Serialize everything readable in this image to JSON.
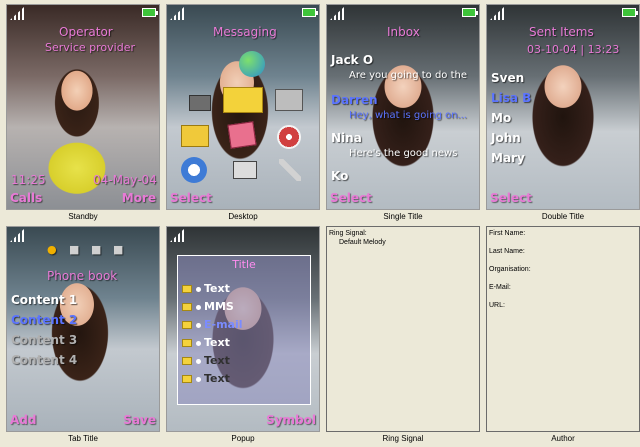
{
  "screens": {
    "standby": {
      "caption": "Standby",
      "operator": "Operator",
      "provider": "Service provider",
      "time": "11:25",
      "date": "04-May-04",
      "left_soft": "Calls",
      "right_soft": "More"
    },
    "desktop": {
      "caption": "Desktop",
      "title": "Messaging",
      "left_soft": "Select",
      "icons": [
        "envelope-icon",
        "radio-icon",
        "camera-icon",
        "folder-icon",
        "disc-icon",
        "tools-icon",
        "game-3d-icon",
        "clock-icon",
        "file-icon"
      ]
    },
    "single_title": {
      "caption": "Single Title",
      "title": "Inbox",
      "items": [
        {
          "name": "Jack O",
          "preview": "Are you going to do the",
          "color": "white"
        },
        {
          "name": "Darren",
          "preview": "Hey, what is going on...",
          "color": "blue"
        },
        {
          "name": "Nina",
          "preview": "Here's the good news",
          "color": "white"
        },
        {
          "name": "Ko",
          "preview": "",
          "color": "white"
        }
      ],
      "left_soft": "Select"
    },
    "double_title": {
      "caption": "Double Title",
      "title": "Sent Items",
      "subtitle": "03-10-04 | 13:23",
      "items": [
        "Sven",
        "Lisa B",
        "Mo",
        "John",
        "Mary"
      ],
      "left_soft": "Select"
    },
    "tab_title": {
      "caption": "Tab Title",
      "title": "Phone book",
      "items": [
        "Content 1",
        "Content 2",
        "Content 3",
        "Content 4"
      ],
      "left_soft": "Add",
      "right_soft": "Save"
    },
    "popup": {
      "caption": "Popup",
      "title": "Title",
      "items": [
        "Text",
        "MMS",
        "E-mail",
        "Text",
        "Text",
        "Text"
      ],
      "right_soft": "Symbol"
    },
    "ring_signal": {
      "caption": "Ring Signal",
      "label": "Ring Signal:",
      "value": "Default Melody"
    },
    "author": {
      "caption": "Author",
      "fields": [
        "First Name:",
        "Last Name:",
        "Organisation:",
        "E-Mail:",
        "URL:"
      ]
    }
  },
  "colors": {
    "accent_pink": "#e87ad6",
    "accent_blue": "#5b74ff",
    "battery_green": "#3ec43a",
    "window_bg": "#ece9d8"
  }
}
